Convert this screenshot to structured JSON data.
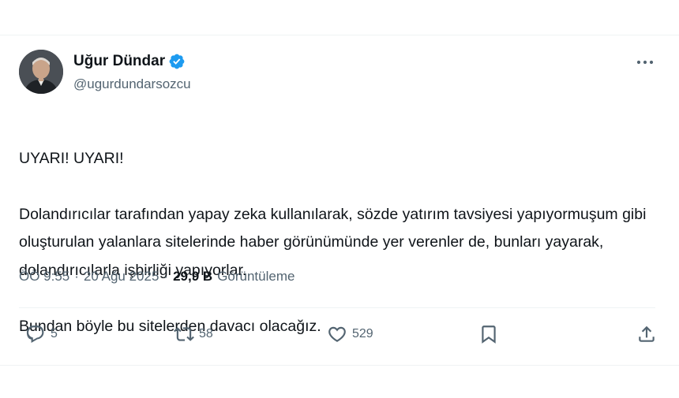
{
  "author": {
    "name": "Uğur Dündar",
    "handle": "@ugurdundarsozcu",
    "verified": true,
    "verified_color": "#1d9bf0"
  },
  "post": {
    "lines": [
      "UYARI! UYARI!",
      "Dolandırıcılar tarafından yapay zeka kullanılarak, sözde yatırım tavsiyesi yapıyormuşum gibi oluşturulan yalanlara sitelerinde haber görünümünde yer verenler de, bunları yayarak, dolandırıcılarla işbirliği yapıyorlar.",
      "Bundan böyle bu sitelerden davacı olacağız."
    ]
  },
  "meta": {
    "time": "ÖÖ 9:55",
    "separator": "·",
    "date": "20 Ağu 2025",
    "views_count": "29,9 B",
    "views_label": "Görüntüleme"
  },
  "actions": {
    "reply_count": "5",
    "repost_count": "58",
    "like_count": "529",
    "icons": [
      "reply-icon",
      "repost-icon",
      "like-icon",
      "bookmark-icon",
      "share-icon"
    ]
  },
  "colors": {
    "text_primary": "#0f1419",
    "text_secondary": "#536471",
    "divider": "#eff3f4"
  }
}
